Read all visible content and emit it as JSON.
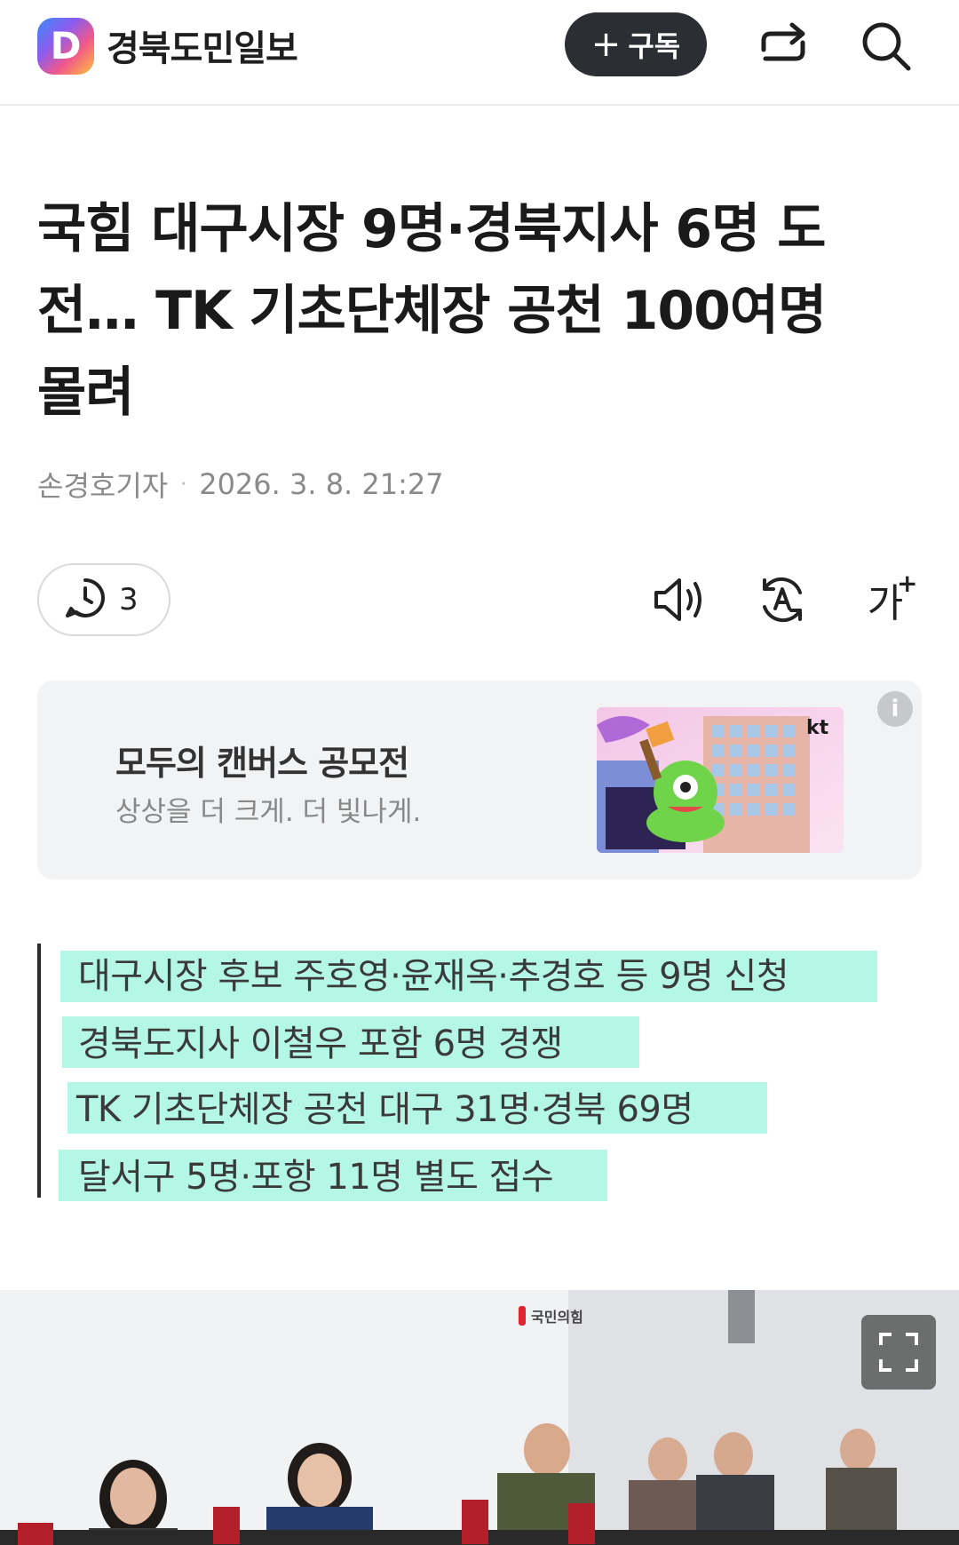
{
  "header": {
    "logo_letter": "D",
    "press_name": "경북도민일보",
    "subscribe_label": "구독",
    "subscribe_plus": "+"
  },
  "article": {
    "title": "국힘 대구시장 9명·경북지사 6명 도전… TK 기초단체장 공천 100여명 몰려",
    "title_lines": [
      "국힘 대구시장 9명·경북지사 6명 도",
      "전… TK 기초단체장 공천 100여명",
      "몰려"
    ],
    "author": "손경호기자",
    "separator": "·",
    "datetime": "2026. 3. 8. 21:27"
  },
  "toolbar": {
    "comment_count": "3",
    "font_size_label": "가"
  },
  "ad": {
    "headline": "모두의 캔버스 공모전",
    "subline": "상상을 더 크게. 더 빛나게.",
    "brand": "kt",
    "info_glyph": "i"
  },
  "summary": [
    "대구시장 후보 주호영·윤재옥·추경호 등 9명 신청",
    "경북도지사 이철우 포함 6명 경쟁",
    "TK 기초단체장 공천 대구 31명·경북 69명",
    "달서구 5명·포항 11명 별도 접수"
  ],
  "photo": {
    "sign_text": "국민의힘"
  },
  "colors": {
    "highlight": "#78f0d2",
    "subscribe_bg": "#2b2e33",
    "ad_bg": "#f2f3f5"
  },
  "icons": [
    "share-icon",
    "search-icon",
    "comment-icon",
    "speaker-icon",
    "translate-icon",
    "font-size-icon",
    "info-icon",
    "expand-icon"
  ]
}
